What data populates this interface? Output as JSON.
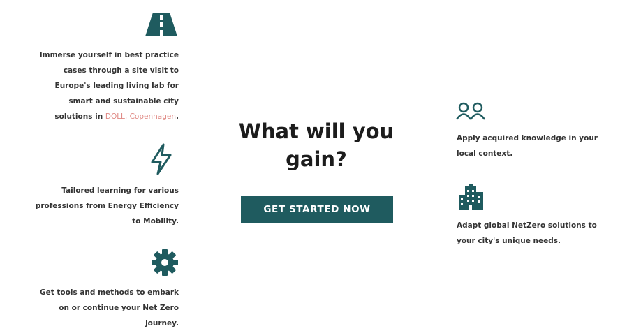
{
  "left_features": [
    {
      "icon": "road-icon",
      "line1": "Immerse yourself in best practice",
      "line2": "cases through a site visit to",
      "line3": "Europe's leading living lab for",
      "line4": "smart and sustainable city",
      "line5_prefix": "solutions in ",
      "line5_link": "DOLL, Copenhagen",
      "line5_suffix": "."
    },
    {
      "icon": "lightning-icon",
      "line1": "Tailored learning for various",
      "line2": "professions from Energy Efficiency",
      "line3": "to Mobility."
    },
    {
      "icon": "gear-icon",
      "line1": "Get tools and methods to embark",
      "line2": "on or continue your Net Zero",
      "line3": "journey."
    }
  ],
  "center": {
    "heading_line1": "What will you",
    "heading_line2": "gain?",
    "cta_label": "GET STARTED NOW"
  },
  "right_features": [
    {
      "icon": "users-icon",
      "line1": "Apply acquired knowledge in your",
      "line2": "local context."
    },
    {
      "icon": "city-buildings-icon",
      "line1": "Adapt global NetZero solutions to",
      "line2": "your city's unique needs."
    }
  ],
  "colors": {
    "accent": "#1f5b5f",
    "link": "#e08a85",
    "text": "#333333"
  }
}
